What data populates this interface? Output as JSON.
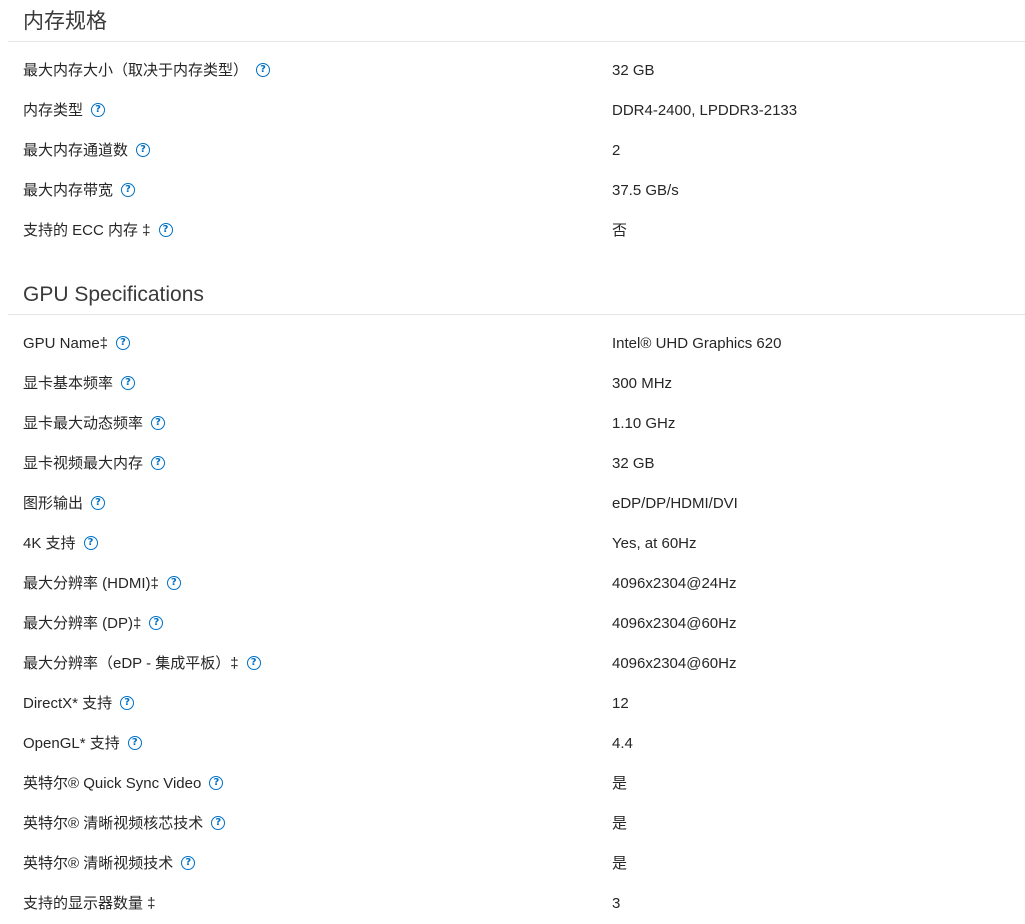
{
  "memory": {
    "title": "内存规格",
    "rows": [
      {
        "label": "最大内存大小（取决于内存类型）",
        "value": "32 GB"
      },
      {
        "label": "内存类型",
        "value": "DDR4-2400, LPDDR3-2133"
      },
      {
        "label": "最大内存通道数",
        "value": "2"
      },
      {
        "label": "最大内存带宽",
        "value": "37.5 GB/s"
      },
      {
        "label": "支持的 ECC 内存 ‡",
        "value": "否"
      }
    ]
  },
  "gpu": {
    "title": "GPU Specifications",
    "rows": [
      {
        "label": "GPU Name‡",
        "value": "Intel® UHD Graphics 620"
      },
      {
        "label": "显卡基本频率",
        "value": "300 MHz"
      },
      {
        "label": "显卡最大动态频率",
        "value": "1.10 GHz"
      },
      {
        "label": "显卡视频最大内存",
        "value": "32 GB"
      },
      {
        "label": "图形输出",
        "value": "eDP/DP/HDMI/DVI"
      },
      {
        "label": "4K 支持",
        "value": "Yes, at 60Hz"
      },
      {
        "label": "最大分辨率 (HDMI)‡",
        "value": "4096x2304@24Hz"
      },
      {
        "label": "最大分辨率 (DP)‡",
        "value": "4096x2304@60Hz"
      },
      {
        "label": "最大分辨率（eDP - 集成平板）‡",
        "value": "4096x2304@60Hz"
      },
      {
        "label": "DirectX* 支持",
        "value": "12"
      },
      {
        "label": "OpenGL* 支持",
        "value": "4.4"
      },
      {
        "label": "英特尔® Quick Sync Video",
        "value": "是"
      },
      {
        "label": "英特尔® 清晰视频核芯技术",
        "value": "是"
      },
      {
        "label": "英特尔® 清晰视频技术",
        "value": "是"
      },
      {
        "label": "支持的显示器数量 ‡",
        "value": "3"
      }
    ]
  },
  "icons": {
    "help": "question-circle-icon",
    "help_glyph": "?",
    "accent": "#0071c5"
  }
}
